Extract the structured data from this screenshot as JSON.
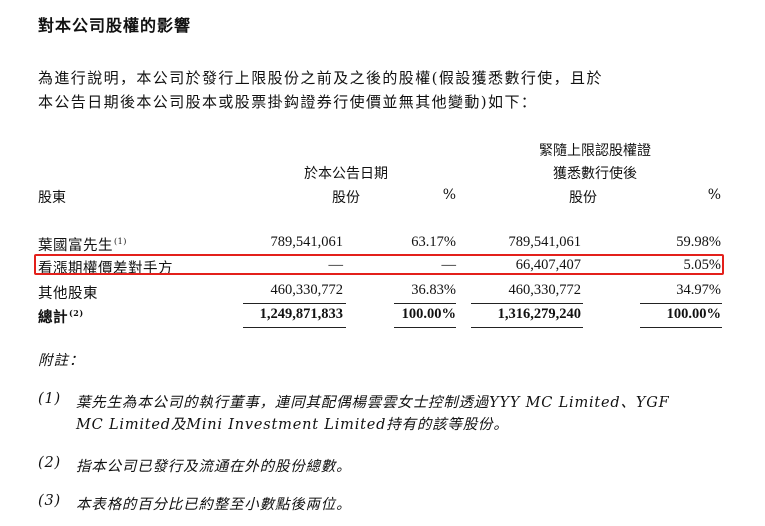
{
  "section_title": "對本公司股權的影響",
  "intro_lines": [
    "為進行說明，本公司於發行上限股份之前及之後的股權(假設獲悉數行使，且於",
    "本公告日期後本公司股本或股票掛鈎證券行使價並無其他變動)如下："
  ],
  "table": {
    "header_group_1": "於本公告日期",
    "header_group_2_line1": "緊隨上限認股權證",
    "header_group_2_line2": "獲悉數行使後",
    "col_shareholder": "股東",
    "col_shares": "股份",
    "col_pct": "%",
    "rows": [
      {
        "name": "葉國富先生",
        "note_ref": "(1)",
        "shares_now": "789,541,061",
        "pct_now": "63.17%",
        "shares_after": "789,541,061",
        "pct_after": "59.98%"
      },
      {
        "name": "看漲期權價差對手方",
        "note_ref": "",
        "shares_now": "—",
        "pct_now": "—",
        "shares_after": "66,407,407",
        "pct_after": "5.05%"
      },
      {
        "name": "其他股東",
        "note_ref": "",
        "shares_now": "460,330,772",
        "pct_now": "36.83%",
        "shares_after": "460,330,772",
        "pct_after": "34.97%"
      },
      {
        "name": "總計",
        "note_ref": "(2)",
        "shares_now": "1,249,871,833",
        "pct_now": "100.00%",
        "shares_after": "1,316,279,240",
        "pct_after": "100.00%"
      }
    ]
  },
  "notes": {
    "title": "附註：",
    "items": [
      {
        "num": "(1)",
        "line1": "葉先生為本公司的執行董事，連同其配偶楊雲雲女士控制透過YYY MC Limited、YGF",
        "line2": "MC Limited及Mini Investment Limited持有的該等股份。"
      },
      {
        "num": "(2)",
        "line1": "指本公司已發行及流通在外的股份總數。",
        "line2": ""
      },
      {
        "num": "(3)",
        "line1": "本表格的百分比已約整至小數點後兩位。",
        "line2": ""
      }
    ]
  },
  "highlight_color": "#e3201b"
}
